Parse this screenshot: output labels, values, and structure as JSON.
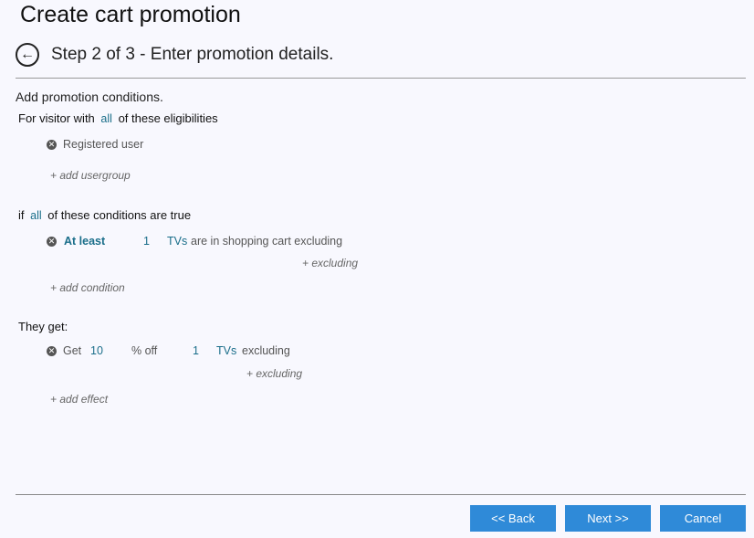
{
  "page": {
    "title": "Create cart promotion",
    "step": "Step 2 of 3 - Enter promotion details.",
    "intro": "Add promotion conditions."
  },
  "eligibility": {
    "prefix": "For visitor with",
    "quantifier": "all",
    "suffix": "of these eligibilities",
    "items": [
      {
        "label": "Registered user"
      }
    ],
    "add_label": "+ add usergroup"
  },
  "conditions": {
    "prefix": "if",
    "quantifier": "all",
    "suffix": "of these conditions are true",
    "item": {
      "operator": "At least",
      "quantity": "1",
      "category": "TVs",
      "text": "are in shopping cart excluding",
      "excluding_label": "+ excluding"
    },
    "add_label": "+ add condition"
  },
  "effects": {
    "heading": "They get:",
    "item": {
      "get": "Get",
      "amount": "10",
      "unit": "% off",
      "quantity": "1",
      "category": "TVs",
      "text": "excluding",
      "excluding_label": "+ excluding"
    },
    "add_label": "+ add effect"
  },
  "footer": {
    "back_label": "<< Back",
    "next_label": "Next >>",
    "cancel_label": "Cancel"
  },
  "colors": {
    "accent": "#2f8ad8",
    "link": "#1a6e8a"
  }
}
